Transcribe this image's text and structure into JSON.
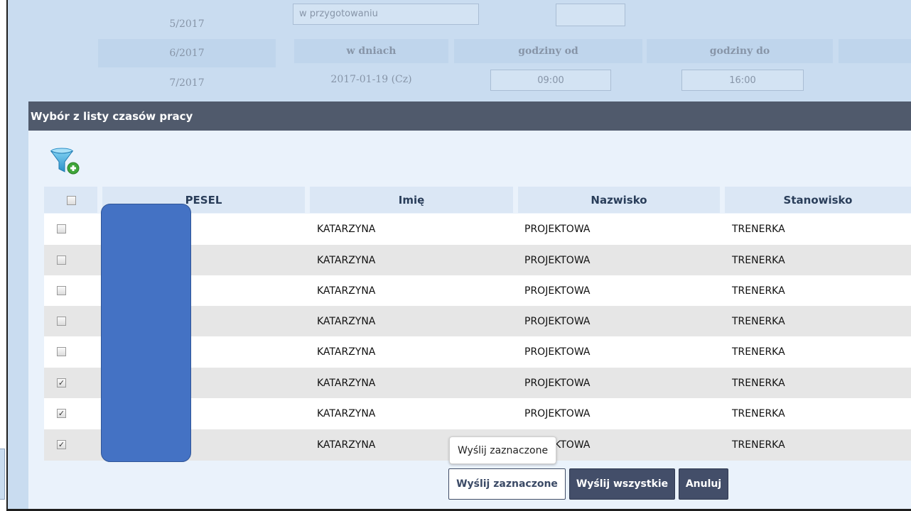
{
  "background": {
    "periods": [
      "5/2017",
      "6/2017",
      "7/2017"
    ],
    "status_value": "w przygotowaniu",
    "headers": {
      "days": "w dniach",
      "hours_from": "godziny od",
      "hours_to": "godziny do"
    },
    "date_value": "2017-01-19 (Cz)",
    "from_value": "09:00",
    "to_value": "16:00"
  },
  "modal": {
    "title": "Wybór z listy czasów pracy",
    "filter_icon": "filter-add-icon",
    "columns": [
      "PESEL",
      "Imię",
      "Nazwisko",
      "Stanowisko"
    ],
    "rows": [
      {
        "checked": false,
        "imie": "KATARZYNA",
        "nazwisko": "PROJEKTOWA",
        "stanowisko": "TRENERKA"
      },
      {
        "checked": false,
        "imie": "KATARZYNA",
        "nazwisko": "PROJEKTOWA",
        "stanowisko": "TRENERKA"
      },
      {
        "checked": false,
        "imie": "KATARZYNA",
        "nazwisko": "PROJEKTOWA",
        "stanowisko": "TRENERKA"
      },
      {
        "checked": false,
        "imie": "KATARZYNA",
        "nazwisko": "PROJEKTOWA",
        "stanowisko": "TRENERKA"
      },
      {
        "checked": false,
        "imie": "KATARZYNA",
        "nazwisko": "PROJEKTOWA",
        "stanowisko": "TRENERKA"
      },
      {
        "checked": true,
        "imie": "KATARZYNA",
        "nazwisko": "PROJEKTOWA",
        "stanowisko": "TRENERKA"
      },
      {
        "checked": true,
        "imie": "KATARZYNA",
        "nazwisko": "PROJEKTOWA",
        "stanowisko": "TRENERKA"
      },
      {
        "checked": true,
        "imie": "KATARZYNA",
        "nazwisko": "PROJEKTOWA",
        "stanowisko": "TRENERKA"
      }
    ],
    "tooltip": "Wyślij zaznaczone",
    "buttons": {
      "send_selected": "Wyślij zaznaczone",
      "send_all": "Wyślij wszystkie",
      "cancel": "Anuluj"
    }
  },
  "colors": {
    "header_bg": "#505a6c",
    "button_dark": "#434e69",
    "redaction": "#4472c4"
  }
}
